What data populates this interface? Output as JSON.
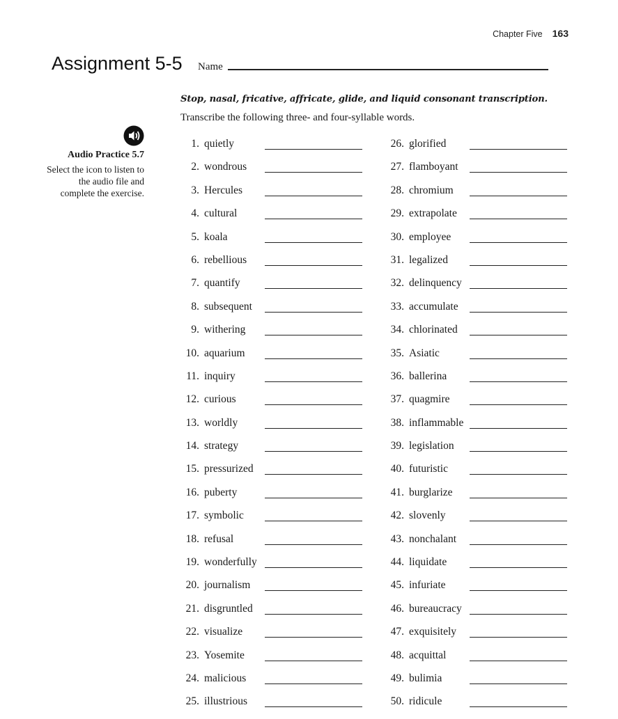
{
  "header": {
    "chapter": "Chapter Five",
    "page_number": "163"
  },
  "title": "Assignment 5-5",
  "name_label": "Name",
  "subtitle": "Stop, nasal, fricative, affricate, glide, and liquid consonant transcription.",
  "instructions": "Transcribe the following three- and four-syllable words.",
  "sidebar": {
    "icon": "speaker-audio-icon",
    "title": "Audio Practice 5.7",
    "text": "Select the icon to listen to the audio file and complete the exercise."
  },
  "items_left": [
    {
      "num": "1.",
      "word": "quietly"
    },
    {
      "num": "2.",
      "word": "wondrous"
    },
    {
      "num": "3.",
      "word": "Hercules"
    },
    {
      "num": "4.",
      "word": "cultural"
    },
    {
      "num": "5.",
      "word": "koala"
    },
    {
      "num": "6.",
      "word": "rebellious"
    },
    {
      "num": "7.",
      "word": "quantify"
    },
    {
      "num": "8.",
      "word": "subsequent"
    },
    {
      "num": "9.",
      "word": "withering"
    },
    {
      "num": "10.",
      "word": "aquarium"
    },
    {
      "num": "11.",
      "word": "inquiry"
    },
    {
      "num": "12.",
      "word": "curious"
    },
    {
      "num": "13.",
      "word": "worldly"
    },
    {
      "num": "14.",
      "word": "strategy"
    },
    {
      "num": "15.",
      "word": "pressurized"
    },
    {
      "num": "16.",
      "word": "puberty"
    },
    {
      "num": "17.",
      "word": "symbolic"
    },
    {
      "num": "18.",
      "word": "refusal"
    },
    {
      "num": "19.",
      "word": "wonderfully"
    },
    {
      "num": "20.",
      "word": "journalism"
    },
    {
      "num": "21.",
      "word": "disgruntled"
    },
    {
      "num": "22.",
      "word": "visualize"
    },
    {
      "num": "23.",
      "word": "Yosemite"
    },
    {
      "num": "24.",
      "word": "malicious"
    },
    {
      "num": "25.",
      "word": "illustrious"
    }
  ],
  "items_right": [
    {
      "num": "26.",
      "word": "glorified"
    },
    {
      "num": "27.",
      "word": "flamboyant"
    },
    {
      "num": "28.",
      "word": "chromium"
    },
    {
      "num": "29.",
      "word": "extrapolate"
    },
    {
      "num": "30.",
      "word": "employee"
    },
    {
      "num": "31.",
      "word": "legalized"
    },
    {
      "num": "32.",
      "word": "delinquency"
    },
    {
      "num": "33.",
      "word": "accumulate"
    },
    {
      "num": "34.",
      "word": "chlorinated"
    },
    {
      "num": "35.",
      "word": "Asiatic"
    },
    {
      "num": "36.",
      "word": "ballerina"
    },
    {
      "num": "37.",
      "word": "quagmire"
    },
    {
      "num": "38.",
      "word": "inflammable"
    },
    {
      "num": "39.",
      "word": "legislation"
    },
    {
      "num": "40.",
      "word": "futuristic"
    },
    {
      "num": "41.",
      "word": "burglarize"
    },
    {
      "num": "42.",
      "word": "slovenly"
    },
    {
      "num": "43.",
      "word": "nonchalant"
    },
    {
      "num": "44.",
      "word": "liquidate"
    },
    {
      "num": "45.",
      "word": "infuriate"
    },
    {
      "num": "46.",
      "word": "bureaucracy"
    },
    {
      "num": "47.",
      "word": "exquisitely"
    },
    {
      "num": "48.",
      "word": "acquittal"
    },
    {
      "num": "49.",
      "word": "bulimia"
    },
    {
      "num": "50.",
      "word": "ridicule"
    }
  ]
}
